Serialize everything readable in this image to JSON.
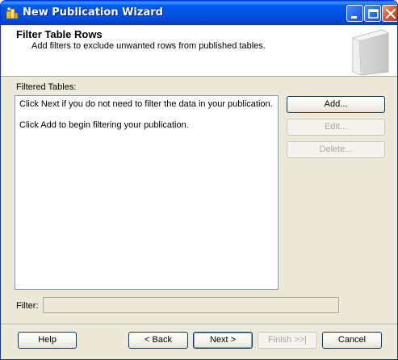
{
  "window": {
    "title": "New Publication Wizard"
  },
  "header": {
    "title": "Filter Table Rows",
    "subtitle": "Add filters to exclude unwanted rows from published tables."
  },
  "filtered_tables": {
    "label": "Filtered Tables:",
    "lines": [
      "Click Next if you do not need to filter the data in your publication.",
      "Click Add to begin filtering your publication."
    ]
  },
  "side_buttons": {
    "add": "Add...",
    "edit": "Edit...",
    "delete": "Delete..."
  },
  "filter": {
    "label": "Filter:",
    "value": ""
  },
  "footer": {
    "help": "Help",
    "back": "< Back",
    "next": "Next >",
    "finish": "Finish >>|",
    "cancel": "Cancel"
  },
  "icons": {
    "app": "wizard-icon",
    "header": "document-stack-icon"
  }
}
